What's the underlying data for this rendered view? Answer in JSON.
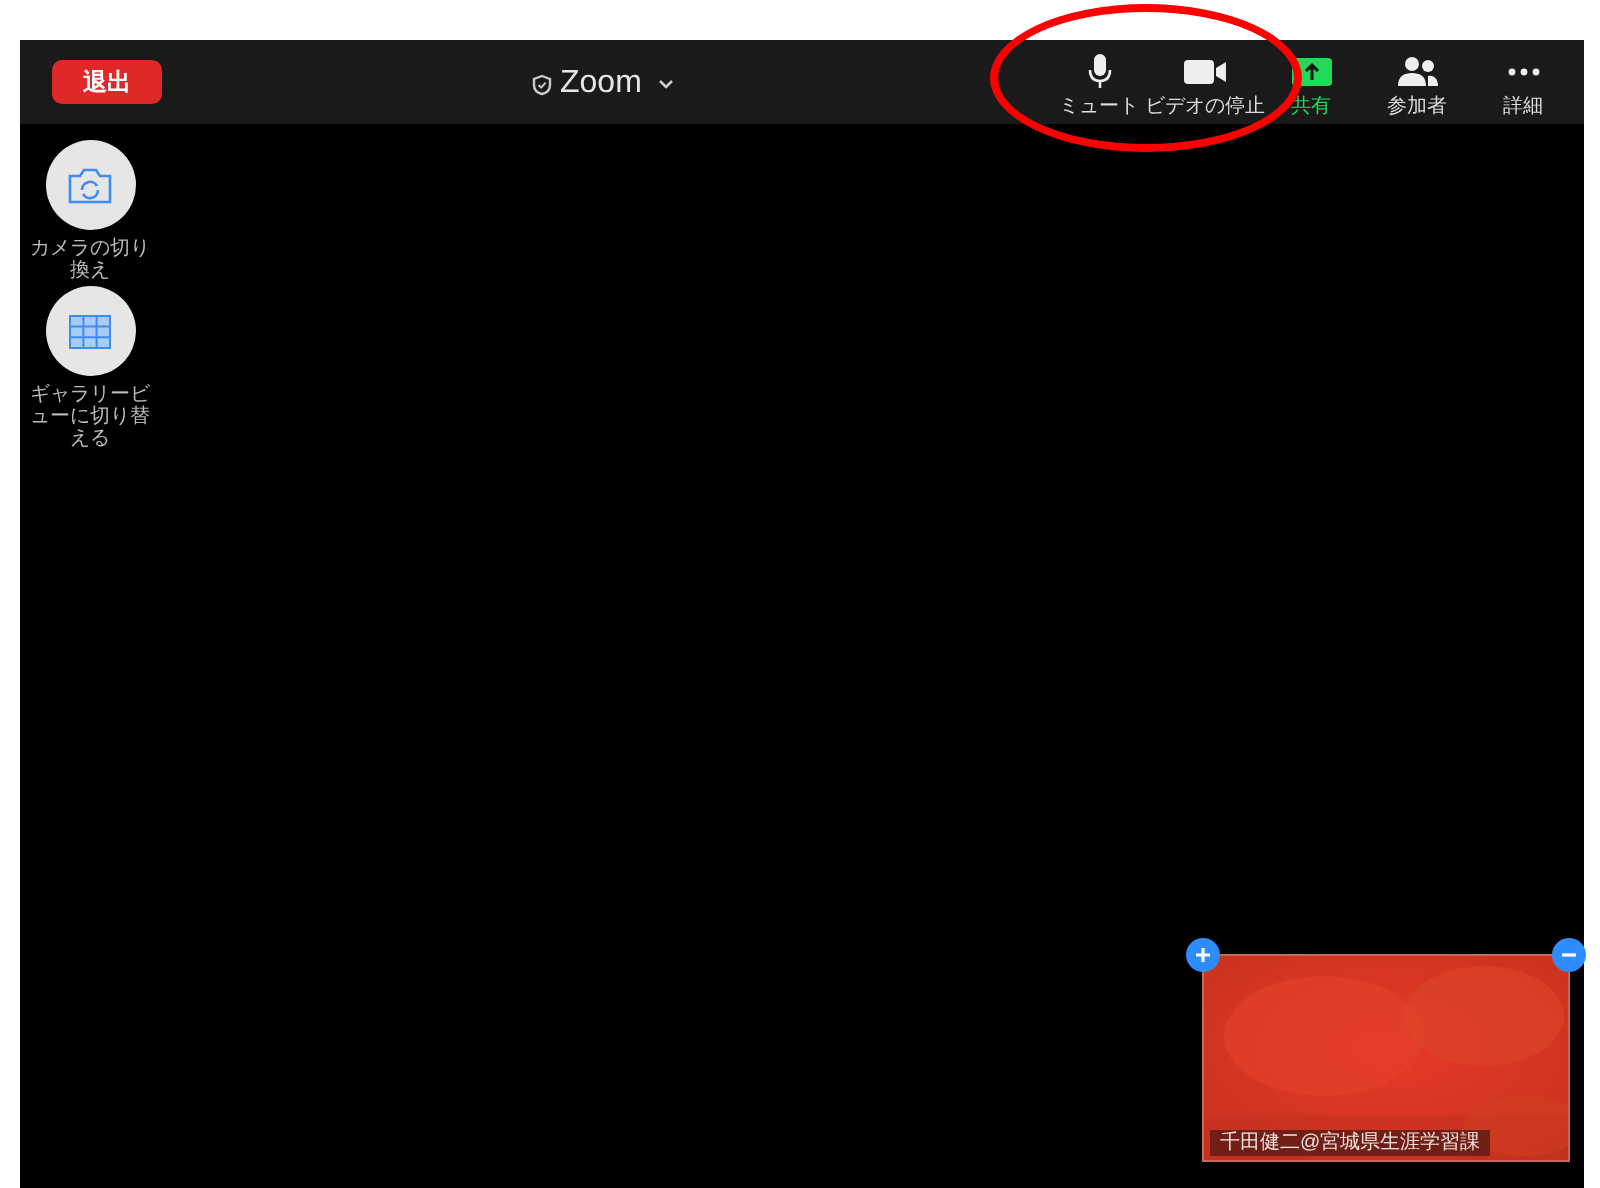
{
  "top_bar": {
    "leave_button": "退出",
    "meeting_title": "Zoom",
    "tools": [
      {
        "kind": "mic",
        "label": "ミュート"
      },
      {
        "kind": "video",
        "label": "ビデオの停止"
      },
      {
        "kind": "share",
        "label": "共有"
      },
      {
        "kind": "participants",
        "label": "参加者"
      },
      {
        "kind": "more",
        "label": "詳細"
      }
    ]
  },
  "side_buttons": [
    {
      "kind": "camera",
      "label": "カメラの切り換え"
    },
    {
      "kind": "gallery",
      "label": "ギャラリービューに切り替える"
    }
  ],
  "self_view": {
    "name": "千田健二@宮城県生涯学習課"
  }
}
